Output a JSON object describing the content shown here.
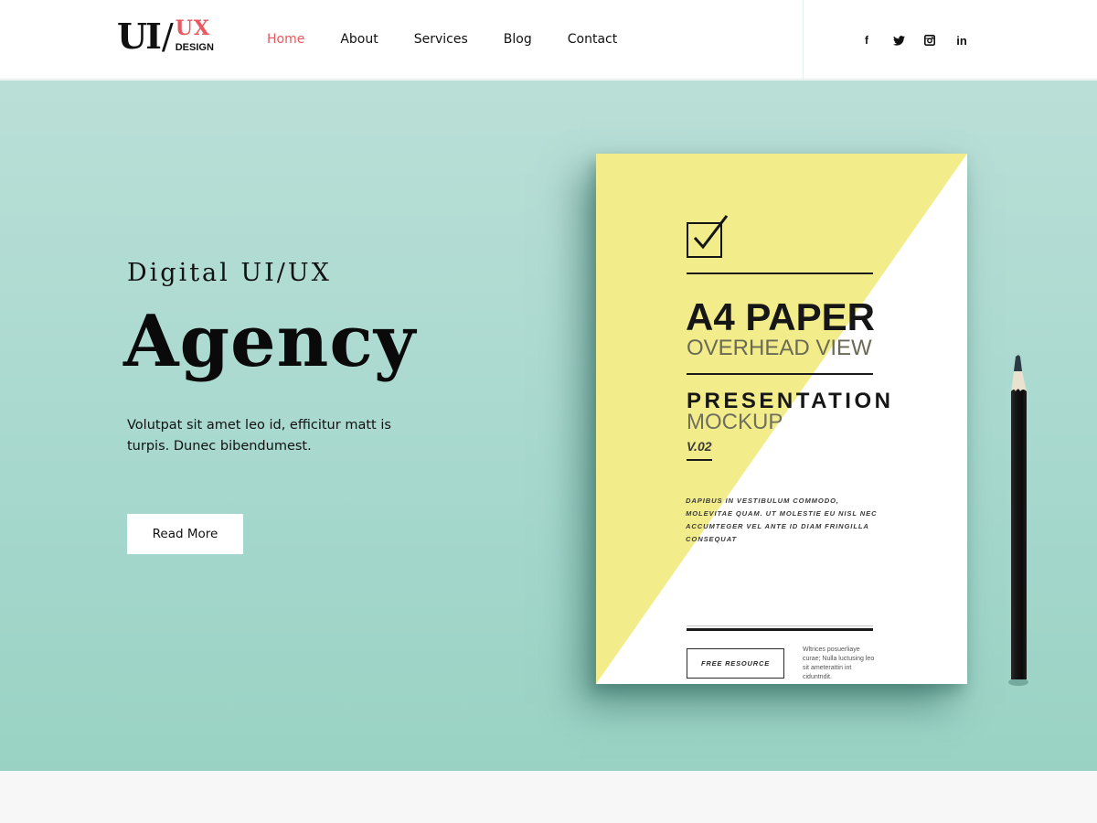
{
  "logo": {
    "left": "UI",
    "slash": "/",
    "accent": "UX",
    "sub": "DESIGN"
  },
  "nav": {
    "items": [
      {
        "label": "Home",
        "active": true
      },
      {
        "label": "About",
        "active": false
      },
      {
        "label": "Services",
        "active": false
      },
      {
        "label": "Blog",
        "active": false
      },
      {
        "label": "Contact",
        "active": false
      }
    ]
  },
  "social": {
    "icons": [
      "facebook-icon",
      "twitter-icon",
      "instagram-icon",
      "linkedin-icon"
    ],
    "facebook_glyph": "f",
    "linkedin_glyph": "in"
  },
  "hero": {
    "subtitle": "Digital UI/UX",
    "title": "Agency",
    "text": "Volutpat sit amet leo id, efficitur matt is turpis. Dunec bibendumest.",
    "cta_label": "Read More"
  },
  "mockup": {
    "heading": "A4 PAPER",
    "subheading": "OVERHEAD VIEW",
    "heading2": "PRESENTATION",
    "subheading2": "MOCKUP",
    "version": "V.02",
    "body": "DAPIBUS IN VESTIBULUM COMMODO, MOLEVITAE QUAM. UT MOLESTIE EU NISL NEC ACCUMTEGER VEL ANTE ID DIAM FRINGILLA CONSEQUAT",
    "button_label": "FREE RESOURCE",
    "side_text": "Wltrices posuerliaye curae; Nulla luctusing leo sit ameterattin int ciduntndit."
  },
  "colors": {
    "accent": "#e8585f",
    "hero_top": "#badfd7",
    "hero_bottom": "#99d2c3",
    "paper_yellow": "#f2ed8a",
    "text_dark": "#111111"
  }
}
